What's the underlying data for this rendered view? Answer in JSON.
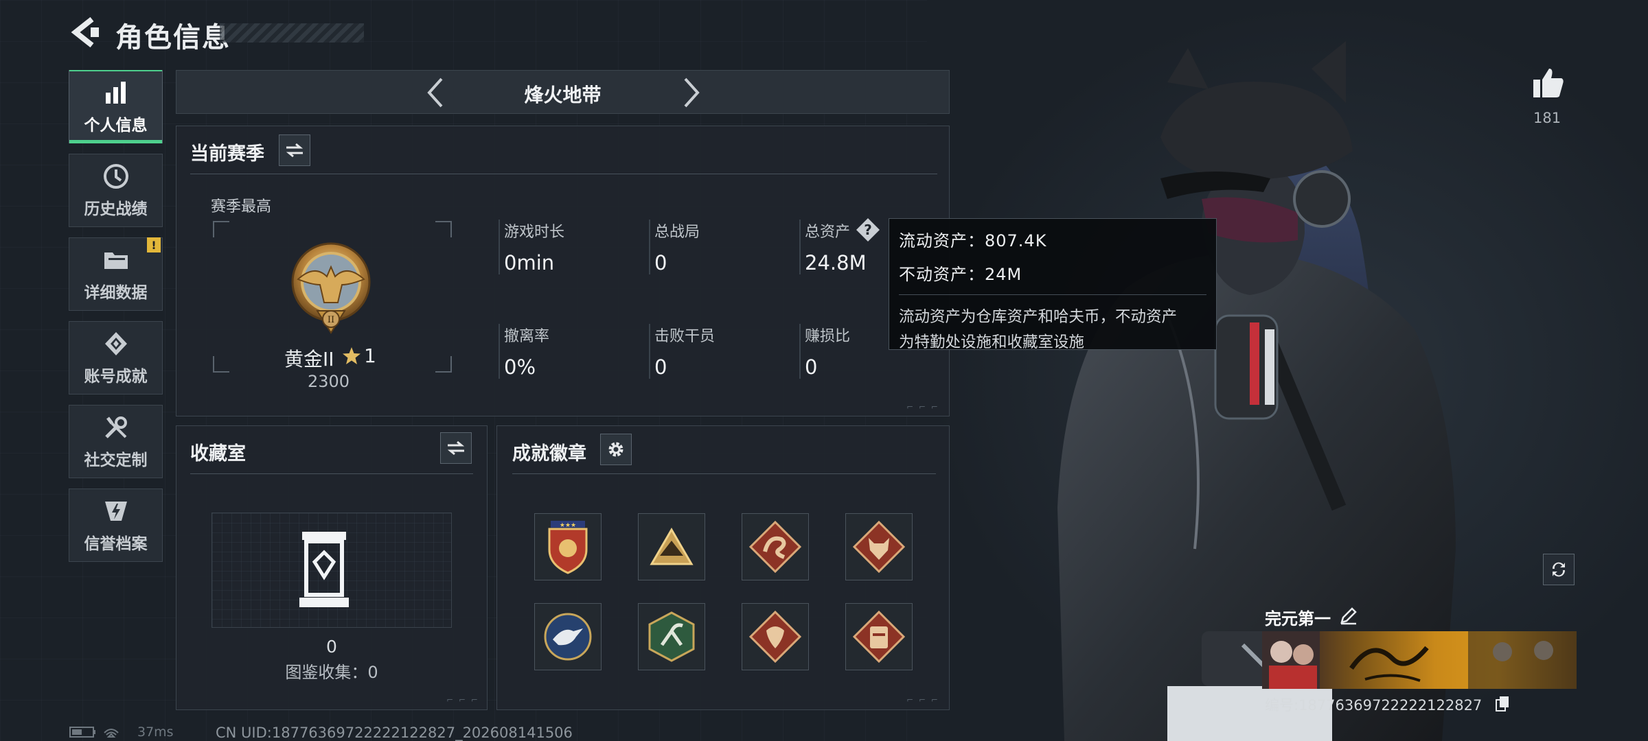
{
  "header": {
    "title": "角色信息"
  },
  "sidebar": {
    "items": [
      {
        "label": "个人信息",
        "icon": "bar-chart-icon",
        "active": true
      },
      {
        "label": "历史战绩",
        "icon": "history-clock-icon"
      },
      {
        "label": "详细数据",
        "icon": "folder-icon",
        "badge": "!"
      },
      {
        "label": "账号成就",
        "icon": "achievement-diamond-icon"
      },
      {
        "label": "社交定制",
        "icon": "wrench-screwdriver-icon"
      },
      {
        "label": "信誉档案",
        "icon": "shield-bolt-icon"
      }
    ]
  },
  "mode": {
    "title": "烽火地带"
  },
  "season": {
    "title": "当前赛季",
    "subtitle": "赛季最高",
    "rank_name": "黄金II",
    "rank_stars": "1",
    "rank_points": "2300",
    "stats": [
      {
        "label": "游戏时长",
        "value": "0min"
      },
      {
        "label": "总战局",
        "value": "0"
      },
      {
        "label": "总资产",
        "value": "24.8M"
      },
      {
        "label": "撤离率",
        "value": "0%"
      },
      {
        "label": "击败干员",
        "value": "0"
      },
      {
        "label": "赚损比",
        "value": "0"
      }
    ]
  },
  "tooltip": {
    "liquid": "流动资产：807.4K",
    "fixed": "不动资产：24M",
    "desc_line1": "流动资产为仓库资产和哈夫币，不动资产",
    "desc_line2": "为特勤处设施和收藏室设施"
  },
  "collection": {
    "title": "收藏室",
    "count": "0",
    "label": "图鉴收集：0"
  },
  "badges": {
    "title": "成就徽章",
    "items": [
      "shield-stars-badge",
      "mountain-triangle-badge",
      "snake-diamond-badge",
      "wolf-diamond-badge",
      "eagle-circle-badge",
      "scorpion-hexagon-badge",
      "dragon-diamond-badge",
      "vest-diamond-badge"
    ]
  },
  "profile": {
    "likes": "181",
    "nickname": "完元第一",
    "uid_line": "编号:18776369722222122827"
  },
  "footer": {
    "ping": "37ms",
    "uid": "CN UID:18776369722222122827_202608141506"
  },
  "colors": {
    "accent": "#4ed08d",
    "badge_warn": "#e3b73a",
    "gold": "#c9891a"
  }
}
